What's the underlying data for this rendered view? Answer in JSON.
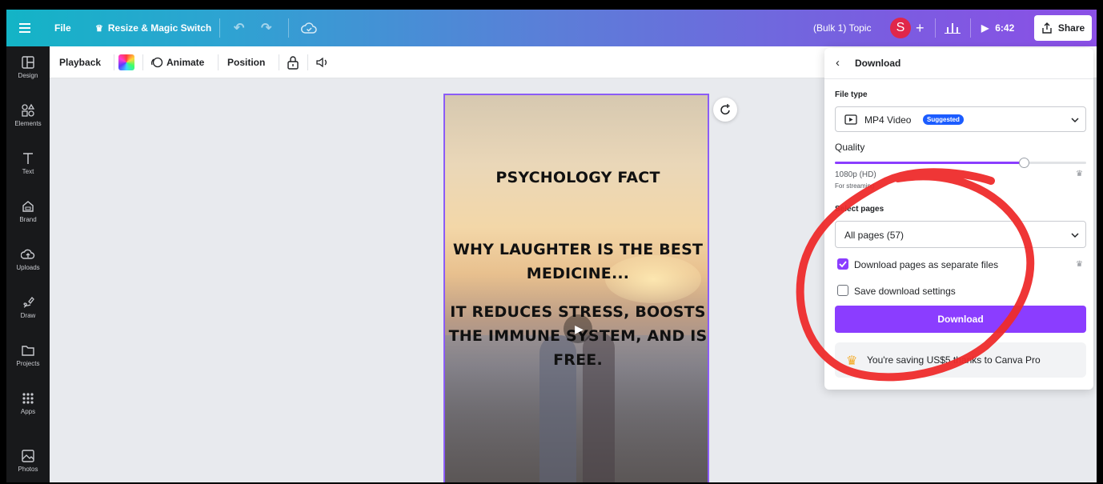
{
  "topbar": {
    "file": "File",
    "resize": "Resize & Magic Switch",
    "title": "(Bulk 1) Topic",
    "avatar_initial": "S",
    "plus": "+",
    "duration": "6:42",
    "share": "Share"
  },
  "rail": {
    "items": [
      {
        "label": "Design",
        "icon": "layout-icon"
      },
      {
        "label": "Elements",
        "icon": "shapes-icon"
      },
      {
        "label": "Text",
        "icon": "text-icon"
      },
      {
        "label": "Brand",
        "icon": "brand-icon"
      },
      {
        "label": "Uploads",
        "icon": "upload-cloud-icon"
      },
      {
        "label": "Draw",
        "icon": "draw-icon"
      },
      {
        "label": "Projects",
        "icon": "folder-icon"
      },
      {
        "label": "Apps",
        "icon": "apps-grid-icon"
      },
      {
        "label": "Photos",
        "icon": "image-icon"
      }
    ]
  },
  "toolbar2": {
    "playback": "Playback",
    "animate": "Animate",
    "position": "Position"
  },
  "page": {
    "title": "PSYCHOLOGY FACT",
    "line1": "WHY LAUGHTER IS THE BEST",
    "line2": "MEDICINE...",
    "line3": "IT REDUCES STRESS, BOOSTS",
    "line4": "THE IMMUNE SYSTEM, AND IS",
    "line5": "FREE."
  },
  "panel": {
    "header": "Download",
    "file_type_label": "File type",
    "file_type_value": "MP4 Video",
    "suggested_badge": "Suggested",
    "quality_label": "Quality",
    "quality_level": 0.75,
    "quality_value": "1080p (HD)",
    "quality_note": "For streaming",
    "select_pages_label": "Select pages",
    "select_pages_value": "All pages (57)",
    "separate_files_label": "Download pages as separate files",
    "separate_files_checked": true,
    "save_settings_label": "Save download settings",
    "save_settings_checked": false,
    "download_button": "Download",
    "promo_text": "You're saving US$5 thanks to Canva Pro"
  },
  "colors": {
    "accent": "#8b3dff",
    "badge": "#1b5cff",
    "annotation": "#ee2b2b"
  }
}
